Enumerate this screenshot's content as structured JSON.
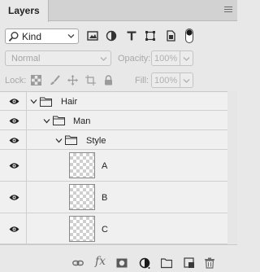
{
  "panel": {
    "tab_label": "Layers",
    "menu_icon": "panel-menu-icon"
  },
  "filter": {
    "kind_label": "Kind",
    "kind_icon": "search-icon",
    "icons": [
      "filter-pixel-layers-icon",
      "filter-adjustment-layers-icon",
      "filter-type-layers-icon",
      "filter-shape-layers-icon",
      "filter-smart-objects-icon"
    ],
    "toggle": "filter-toggle-icon"
  },
  "blend": {
    "mode": "Normal",
    "opacity_label": "Opacity:",
    "opacity_value": "100%"
  },
  "lock": {
    "label": "Lock:",
    "icons": [
      "lock-transparent-pixels-icon",
      "lock-image-pixels-icon",
      "lock-position-icon",
      "lock-artboard-icon",
      "lock-all-icon"
    ],
    "fill_label": "Fill:",
    "fill_value": "100%"
  },
  "layers": [
    {
      "name": "Hair",
      "type": "group",
      "depth": 0,
      "expanded": true
    },
    {
      "name": "Man",
      "type": "group",
      "depth": 1,
      "expanded": true
    },
    {
      "name": "Style",
      "type": "group",
      "depth": 2,
      "expanded": true
    },
    {
      "name": "A",
      "type": "pixel",
      "depth": 3
    },
    {
      "name": "B",
      "type": "pixel",
      "depth": 3
    },
    {
      "name": "C",
      "type": "pixel",
      "depth": 3
    }
  ],
  "footer": {
    "icons": [
      "link-layers-icon",
      "fx-icon",
      "add-mask-icon",
      "adjustment-layer-icon",
      "new-group-icon",
      "new-layer-icon",
      "trash-icon"
    ],
    "fx_text": "fx"
  },
  "colors": {
    "panel_bg": "#e8e8e8",
    "row_bg": "#f0f0f0",
    "icon": "#5a5a5a",
    "disabled": "#a8a8a8"
  }
}
